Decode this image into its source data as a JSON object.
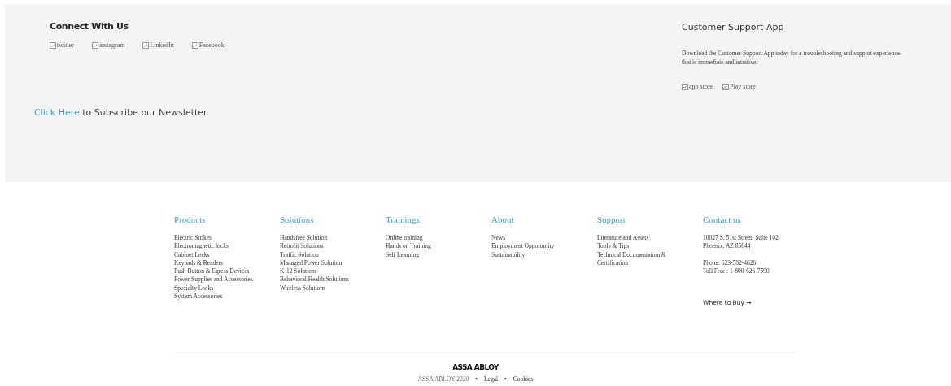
{
  "connect": {
    "title": "Connect With Us",
    "social": [
      {
        "alt": "twitter"
      },
      {
        "alt": "instagram"
      },
      {
        "alt": "LinkedIn"
      },
      {
        "alt": "Facebook"
      }
    ],
    "newsletter": {
      "link": "Click Here",
      "text": "to Subscribe our Newsletter."
    }
  },
  "app": {
    "title": "Customer Support App",
    "description": "Download the Customer Support App today for a troubleshooting and support experience that is immediate and intuitive.",
    "stores": [
      {
        "alt": "app store"
      },
      {
        "alt": "Play store"
      }
    ]
  },
  "columns": [
    {
      "heading": "Products",
      "links": [
        "Electric Strikes",
        "Electromagnetic locks",
        "Cabinet Locks",
        "Keypads & Readers",
        "Push Button & Egress Devices",
        "Power Supplies and Accessories",
        "Specialty Locks",
        "System Accessories"
      ]
    },
    {
      "heading": "Solutions",
      "links": [
        "Handsfree Solution",
        "Retrofit Solutions",
        "Traffic Solution",
        "Managed Power Solution",
        "K-12 Solutions",
        "Behavioral Health Solutions",
        "Wireless Solutions"
      ]
    },
    {
      "heading": "Trainings",
      "links": [
        "Online training",
        "Hands on Training",
        "Self Learning"
      ]
    },
    {
      "heading": "About",
      "links": [
        "News",
        "Employment Opportunity",
        "Sustainability"
      ]
    },
    {
      "heading": "Support",
      "links": [
        "Literature and Assets",
        "Tools & Tips",
        "Technical Documentation & Certification"
      ]
    }
  ],
  "contact": {
    "heading": "Contact us",
    "address": [
      "10027 S. 51st Street, Suite 102",
      "Phoenix, AZ 85044"
    ],
    "phones": [
      "Phone: 623-582-4626",
      "Toll Free : 1-800-626-7590"
    ],
    "where_to_buy": "Where to Buy →"
  },
  "bottom": {
    "logo": "ASSA ABLOY",
    "items": [
      {
        "kind": "text",
        "text": "ASSA ABLOY 2020"
      },
      {
        "kind": "sep",
        "text": "•"
      },
      {
        "kind": "link",
        "text": "Legal"
      },
      {
        "kind": "sep",
        "text": "•"
      },
      {
        "kind": "link",
        "text": "Cookies"
      }
    ]
  }
}
